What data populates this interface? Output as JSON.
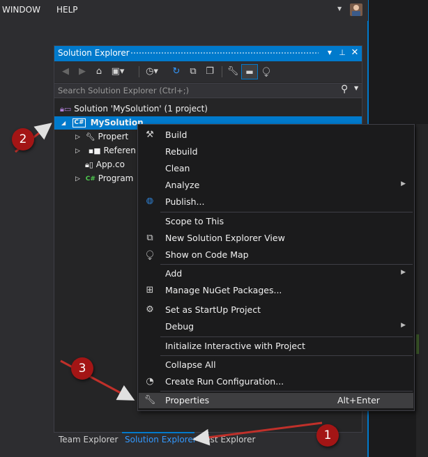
{
  "menubar": {
    "window": "WINDOW",
    "help": "HELP"
  },
  "solution_explorer": {
    "title": "Solution Explorer",
    "search_placeholder": "Search Solution Explorer (Ctrl+;)",
    "tree": {
      "solution": "Solution 'MySolution' (1 project)",
      "project": "MySolution",
      "properties": "Propert",
      "references": "Referen",
      "app_config": "App.co",
      "program": "Program"
    }
  },
  "bottom_tabs": [
    "Team Explorer",
    "Solution Explorer",
    "Test Explorer"
  ],
  "context_menu": {
    "build": "Build",
    "rebuild": "Rebuild",
    "clean": "Clean",
    "analyze": "Analyze",
    "publish": "Publish...",
    "scope_to_this": "Scope to This",
    "new_se_view": "New Solution Explorer View",
    "show_on_code_map": "Show on Code Map",
    "add": "Add",
    "manage_nuget": "Manage NuGet Packages...",
    "set_startup": "Set as StartUp Project",
    "debug": "Debug",
    "init_interactive": "Initialize Interactive with Project",
    "collapse_all": "Collapse All",
    "create_run_config": "Create Run Configuration...",
    "properties": "Properties",
    "properties_shortcut": "Alt+Enter"
  },
  "annotations": {
    "badge1": "1",
    "badge2": "2",
    "badge3": "3"
  },
  "colors": {
    "accent": "#007acc",
    "annotation": "#a31515",
    "menu_bg": "#1b1b1c"
  }
}
